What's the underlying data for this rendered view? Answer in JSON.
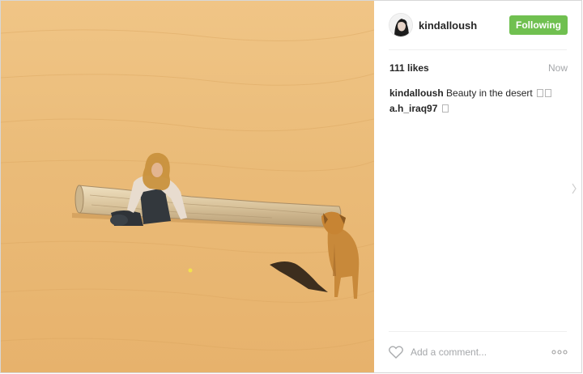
{
  "header": {
    "username": "kindalloush",
    "follow_label": "Following"
  },
  "stats": {
    "likes": "111 likes",
    "time": "Now"
  },
  "comments": [
    {
      "author": "kindalloush",
      "text": "Beauty in the desert"
    },
    {
      "author": "a.h_iraq97",
      "text": ""
    }
  ],
  "footer": {
    "comment_placeholder": "Add a comment..."
  },
  "colors": {
    "follow_button": "#70c050",
    "sand": "#e9b873"
  }
}
